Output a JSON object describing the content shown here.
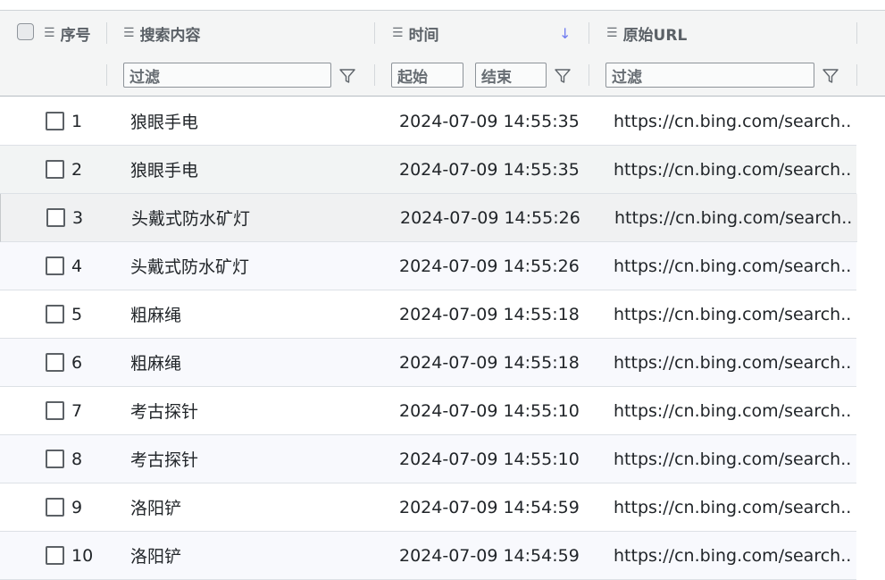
{
  "table": {
    "columns": {
      "index": "序号",
      "search": "搜索内容",
      "time": "时间",
      "url": "原始URL"
    },
    "filters": {
      "search_placeholder": "过滤",
      "time_start": "起始",
      "time_end": "结束",
      "url_placeholder": "过滤"
    },
    "sort_icon": "↓",
    "rows": [
      {
        "index": "1",
        "term": "狼眼手电",
        "time": "2024-07-09 14:55:35",
        "url": "https://cn.bing.com/search..."
      },
      {
        "index": "2",
        "term": "狼眼手电",
        "time": "2024-07-09 14:55:35",
        "url": "https://cn.bing.com/search..."
      },
      {
        "index": "3",
        "term": "头戴式防水矿灯",
        "time": "2024-07-09 14:55:26",
        "url": "https://cn.bing.com/search..."
      },
      {
        "index": "4",
        "term": "头戴式防水矿灯",
        "time": "2024-07-09 14:55:26",
        "url": "https://cn.bing.com/search..."
      },
      {
        "index": "5",
        "term": "粗麻绳",
        "time": "2024-07-09 14:55:18",
        "url": "https://cn.bing.com/search..."
      },
      {
        "index": "6",
        "term": "粗麻绳",
        "time": "2024-07-09 14:55:18",
        "url": "https://cn.bing.com/search..."
      },
      {
        "index": "7",
        "term": "考古探针",
        "time": "2024-07-09 14:55:10",
        "url": "https://cn.bing.com/search..."
      },
      {
        "index": "8",
        "term": "考古探针",
        "time": "2024-07-09 14:55:10",
        "url": "https://cn.bing.com/search..."
      },
      {
        "index": "9",
        "term": "洛阳铲",
        "time": "2024-07-09 14:54:59",
        "url": "https://cn.bing.com/search..."
      },
      {
        "index": "10",
        "term": "洛阳铲",
        "time": "2024-07-09 14:54:59",
        "url": "https://cn.bing.com/search..."
      }
    ]
  }
}
